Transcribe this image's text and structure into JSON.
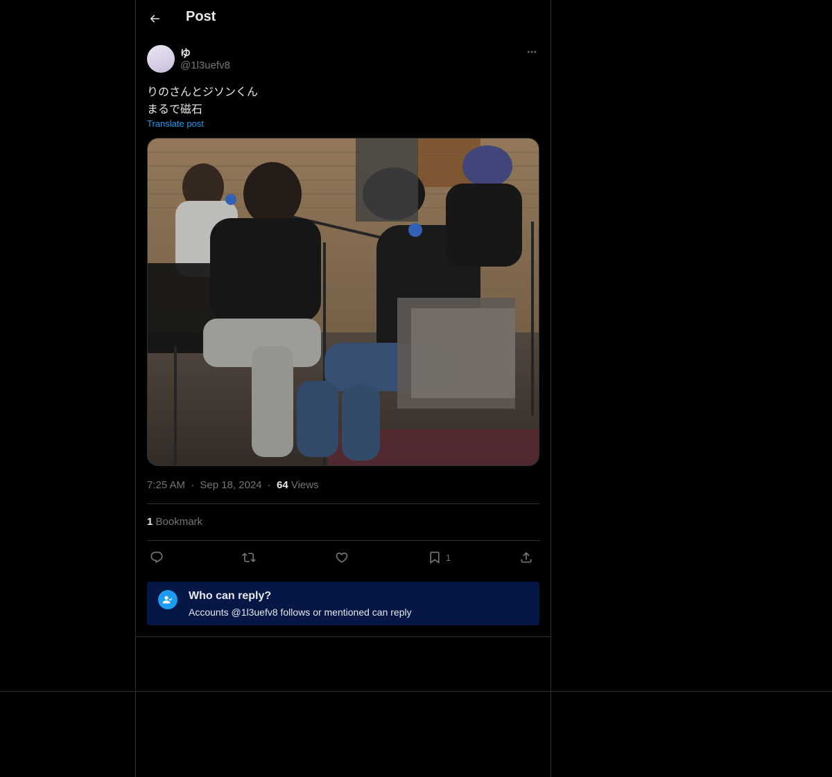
{
  "header": {
    "title": "Post",
    "back_icon": "arrow-left-icon"
  },
  "post": {
    "author": {
      "display_name": "ゆ",
      "handle": "@1l3uefv8"
    },
    "text_lines": [
      "りのさんとジソンくん",
      "まるで磁石"
    ],
    "translate_label": "Translate post",
    "media_alt": "Photo of musicians seated in a rehearsal room with microphones",
    "time": "7:25 AM",
    "date": "Sep 18, 2024",
    "separator": "·",
    "views_count": "64",
    "views_label": "Views",
    "bookmark_count": "1",
    "bookmark_label": "Bookmark"
  },
  "actions": {
    "reply_icon": "speech-bubble-icon",
    "repost_icon": "repost-icon",
    "like_icon": "heart-icon",
    "bookmark_icon": "bookmark-icon",
    "bookmark_count": "1",
    "share_icon": "share-upload-icon"
  },
  "reply_restriction": {
    "title": "Who can reply?",
    "subtitle": "Accounts @1l3uefv8 follows or mentioned can reply",
    "icon": "user-check-icon"
  },
  "colors": {
    "background": "#000000",
    "text_primary": "#e7e9ea",
    "text_secondary": "#71767b",
    "accent": "#1d9bf0",
    "reply_box_bg": "#061746",
    "border": "#2f3336"
  }
}
